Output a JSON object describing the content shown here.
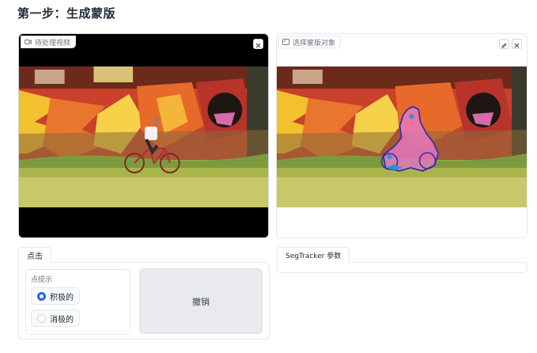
{
  "page": {
    "title": "第一步：生成蒙版"
  },
  "video_panel": {
    "label": "待处理视频",
    "label_icon": "video-icon",
    "close_icon": "close-icon"
  },
  "mask_panel": {
    "label": "选择蒙版对象",
    "label_icon": "image-icon",
    "edit_icon": "pencil-icon",
    "close_icon": "close-icon"
  },
  "click_tab": {
    "tab_label": "点击",
    "group_label": "点提示",
    "options": [
      {
        "label": "积极的",
        "checked": true
      },
      {
        "label": "消极的",
        "checked": false
      }
    ],
    "undo_label": "撤销"
  },
  "segtracker_tab": {
    "tab_label": "SegTracker 参数"
  },
  "colors": {
    "accent": "#2563eb",
    "mask_fill": "#e879c9",
    "mask_outline": "#3730a3"
  }
}
